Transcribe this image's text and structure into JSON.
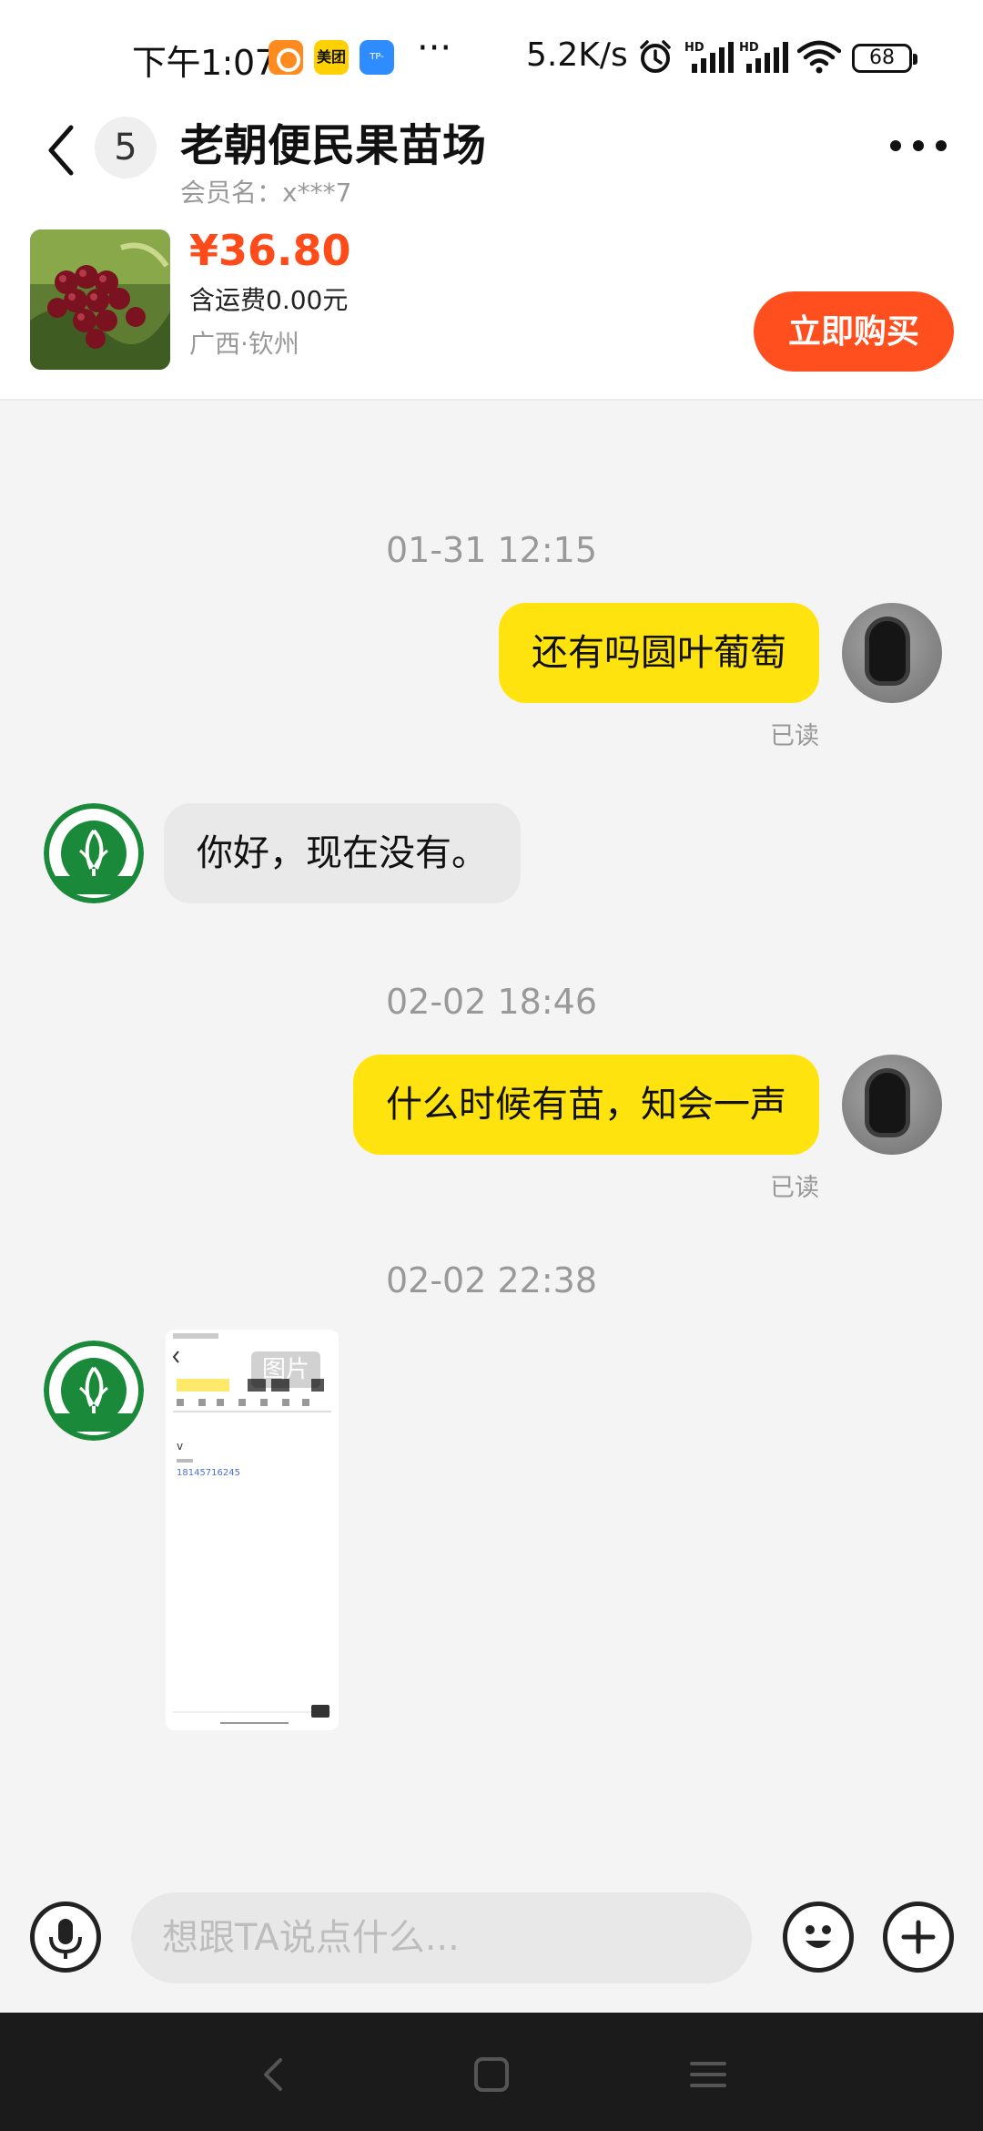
{
  "status_bar": {
    "time": "下午1:07",
    "app_icons": [
      "orange-app-icon",
      "meituan-app-icon",
      "tplink-app-icon"
    ],
    "meituan_label": "美团",
    "tplink_label": "TP-LINK",
    "more_dots": "···",
    "network_speed": "5.2K/s",
    "battery": "68"
  },
  "header": {
    "unread_count": "5",
    "shop_name": "老朝便民果苗场",
    "member_label": "会员名：x***7"
  },
  "product": {
    "price": "¥36.80",
    "shipping": "含运费0.00元",
    "location": "广西·钦州",
    "buy_label": "立即购买"
  },
  "messages": [
    {
      "timestamp": "01-31 12:15"
    },
    {
      "sender": "me",
      "text": "还有吗圆叶葡萄",
      "status": "已读"
    },
    {
      "sender": "shop",
      "text": "你好，现在没有。"
    },
    {
      "timestamp": "02-02 18:46"
    },
    {
      "sender": "me",
      "text": "什么时候有苗，知会一声",
      "status": "已读"
    },
    {
      "timestamp": "02-02 22:38"
    },
    {
      "sender": "shop",
      "type": "image",
      "tag": "图片",
      "phone": "18145716245"
    }
  ],
  "input": {
    "placeholder": "想跟TA说点什么..."
  },
  "colors": {
    "accent": "#ff4f1f",
    "my_bubble": "#ffe30f",
    "their_bubble": "#e9e9e9"
  }
}
